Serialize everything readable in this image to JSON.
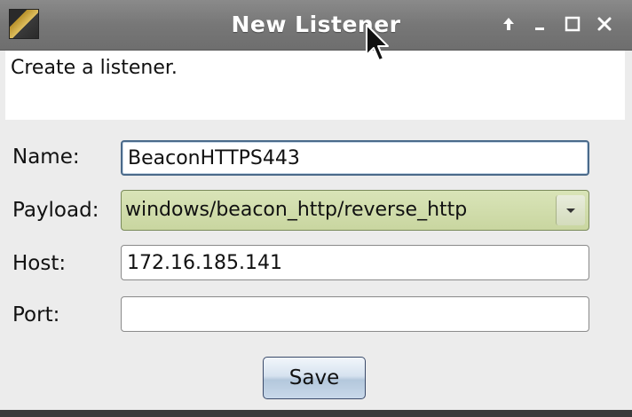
{
  "window": {
    "title": "New Listener",
    "controls": {
      "up": "↑",
      "minimize": "_",
      "maximize": "□",
      "close": "✕"
    }
  },
  "header": {
    "text": "Create a listener."
  },
  "form": {
    "name_label": "Name:",
    "name_value": "BeaconHTTPS443",
    "payload_label": "Payload:",
    "payload_value": "windows/beacon_http/reverse_http",
    "host_label": "Host:",
    "host_value": "172.16.185.141",
    "port_label": "Port:",
    "port_value": ""
  },
  "actions": {
    "save_label": "Save"
  },
  "icons": {
    "app": "app-icon",
    "dropdown": "chevron-down-icon",
    "cursor": "mouse-pointer-icon"
  },
  "colors": {
    "titlebar": "#777777",
    "payload_bg": "#d2dcaa",
    "save_bg": "#c8d8ea"
  }
}
